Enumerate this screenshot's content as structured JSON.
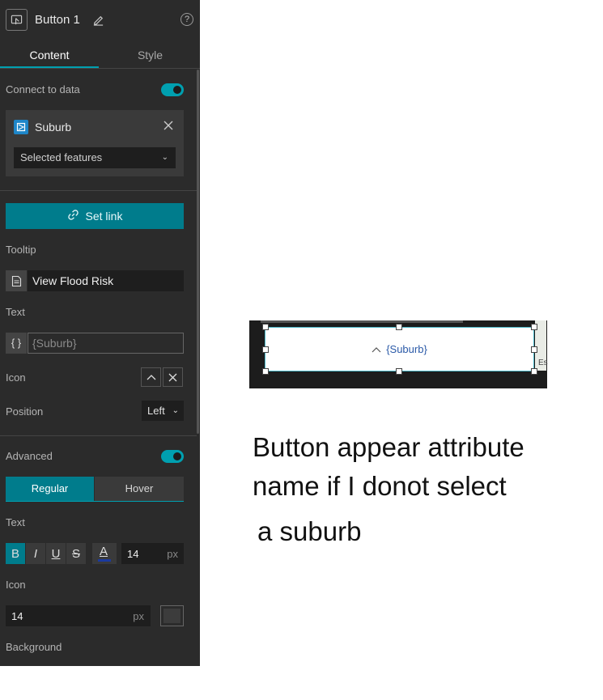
{
  "header": {
    "title": "Button 1"
  },
  "tabs": [
    {
      "label": "Content",
      "active": true
    },
    {
      "label": "Style",
      "active": false
    }
  ],
  "connect_to_data": {
    "label": "Connect to data",
    "on": true
  },
  "data_source": {
    "name": "Suburb",
    "selection": "Selected features"
  },
  "set_link": {
    "label": "Set link"
  },
  "tooltip": {
    "label": "Tooltip",
    "value": "View Flood Risk"
  },
  "text": {
    "label": "Text",
    "value": "{Suburb}"
  },
  "icon": {
    "label": "Icon"
  },
  "position": {
    "label": "Position",
    "value": "Left"
  },
  "advanced": {
    "label": "Advanced",
    "on": true
  },
  "state_tabs": {
    "regular": "Regular",
    "hover": "Hover"
  },
  "text_style": {
    "label": "Text",
    "bold": "B",
    "italic": "I",
    "underline": "U",
    "strike": "S",
    "size": "14",
    "unit": "px"
  },
  "icon_style": {
    "label": "Icon",
    "size": "14",
    "unit": "px"
  },
  "background": {
    "label": "Background"
  },
  "preview": {
    "button_text": "{Suburb}",
    "edge_text": "Es"
  },
  "note": {
    "lines": [
      "Button appear attribute",
      "name if I donot select",
      "a suburb"
    ]
  },
  "colors": {
    "accent": "#00a0b0",
    "button_teal": "#007c8c",
    "panel_bg": "#2b2b2b",
    "layer_icon": "#1e86c8"
  }
}
